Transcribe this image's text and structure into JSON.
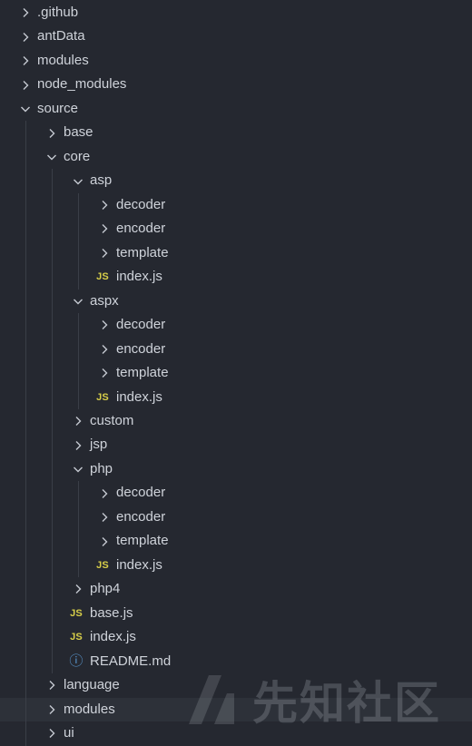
{
  "explorer": {
    "items": [
      {
        "label": ".github",
        "type": "folder",
        "expanded": false,
        "depth": 0
      },
      {
        "label": "antData",
        "type": "folder",
        "expanded": false,
        "depth": 0
      },
      {
        "label": "modules",
        "type": "folder",
        "expanded": false,
        "depth": 0
      },
      {
        "label": "node_modules",
        "type": "folder",
        "expanded": false,
        "depth": 0
      },
      {
        "label": "source",
        "type": "folder",
        "expanded": true,
        "depth": 0
      },
      {
        "label": "base",
        "type": "folder",
        "expanded": false,
        "depth": 1
      },
      {
        "label": "core",
        "type": "folder",
        "expanded": true,
        "depth": 1
      },
      {
        "label": "asp",
        "type": "folder",
        "expanded": true,
        "depth": 2
      },
      {
        "label": "decoder",
        "type": "folder",
        "expanded": false,
        "depth": 3
      },
      {
        "label": "encoder",
        "type": "folder",
        "expanded": false,
        "depth": 3
      },
      {
        "label": "template",
        "type": "folder",
        "expanded": false,
        "depth": 3
      },
      {
        "label": "index.js",
        "type": "js",
        "depth": 3
      },
      {
        "label": "aspx",
        "type": "folder",
        "expanded": true,
        "depth": 2
      },
      {
        "label": "decoder",
        "type": "folder",
        "expanded": false,
        "depth": 3
      },
      {
        "label": "encoder",
        "type": "folder",
        "expanded": false,
        "depth": 3
      },
      {
        "label": "template",
        "type": "folder",
        "expanded": false,
        "depth": 3
      },
      {
        "label": "index.js",
        "type": "js",
        "depth": 3
      },
      {
        "label": "custom",
        "type": "folder",
        "expanded": false,
        "depth": 2
      },
      {
        "label": "jsp",
        "type": "folder",
        "expanded": false,
        "depth": 2
      },
      {
        "label": "php",
        "type": "folder",
        "expanded": true,
        "depth": 2
      },
      {
        "label": "decoder",
        "type": "folder",
        "expanded": false,
        "depth": 3
      },
      {
        "label": "encoder",
        "type": "folder",
        "expanded": false,
        "depth": 3
      },
      {
        "label": "template",
        "type": "folder",
        "expanded": false,
        "depth": 3
      },
      {
        "label": "index.js",
        "type": "js",
        "depth": 3
      },
      {
        "label": "php4",
        "type": "folder",
        "expanded": false,
        "depth": 2
      },
      {
        "label": "base.js",
        "type": "js",
        "depth": 2
      },
      {
        "label": "index.js",
        "type": "js",
        "depth": 2
      },
      {
        "label": "README.md",
        "type": "info",
        "depth": 2
      },
      {
        "label": "language",
        "type": "folder",
        "expanded": false,
        "depth": 1
      },
      {
        "label": "modules",
        "type": "folder",
        "expanded": false,
        "depth": 1,
        "selected": true
      },
      {
        "label": "ui",
        "type": "folder",
        "expanded": false,
        "depth": 1
      }
    ],
    "js_badge": "JS",
    "info_badge": "ⓘ",
    "icons": {
      "collapsed": "chevron-right-icon",
      "expanded": "chevron-down-icon",
      "js": "javascript-file-icon",
      "info": "info-icon"
    }
  },
  "watermark": {
    "text": "先知社区"
  },
  "colors": {
    "background": "#252830",
    "text": "#cfd3da",
    "js_badge": "#d8cf49",
    "info_badge": "#5b9bd5",
    "selected_row": "#2d3139",
    "indent_guide": "#3a3e47"
  }
}
